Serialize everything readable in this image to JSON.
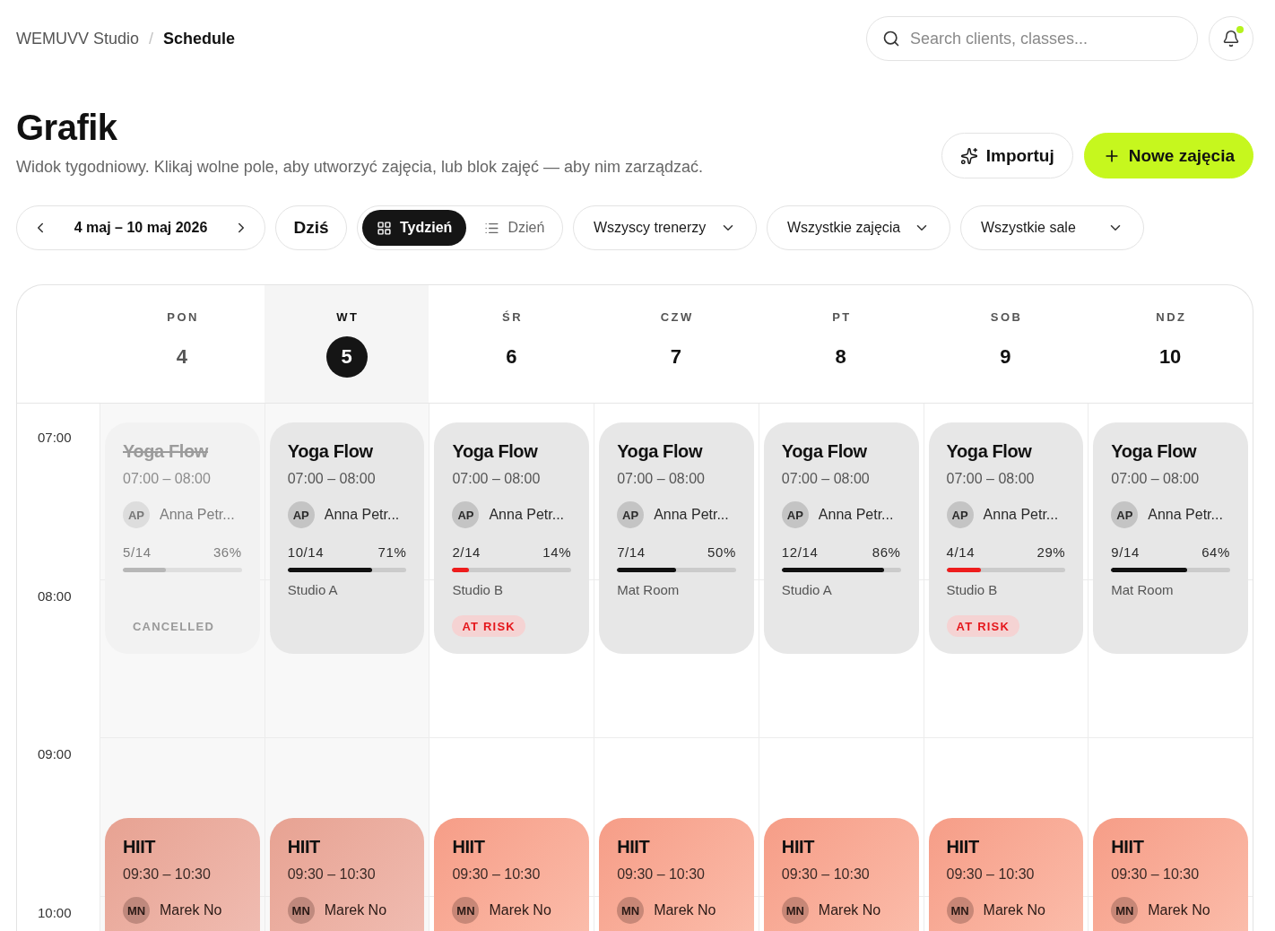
{
  "breadcrumb": {
    "parent": "WEMUVV Studio",
    "separator": "/",
    "current": "Schedule"
  },
  "search": {
    "placeholder": "Search clients, classes..."
  },
  "notifications": {
    "unread": true
  },
  "header": {
    "title": "Grafik",
    "subtitle": "Widok tygodniowy. Klikaj wolne pole, aby utworzyć zajęcia, lub blok zajęć — aby nim zarządzać."
  },
  "actions": [
    {
      "kind": "import",
      "label": "Importuj"
    },
    {
      "kind": "create",
      "label": "Nowe zajęcia"
    }
  ],
  "toolbar": {
    "date_range": "4 maj – 10 maj 2026",
    "today_button": "Dziś",
    "views": [
      {
        "kind": "week",
        "label": "Tydzień",
        "selected": true
      },
      {
        "kind": "day",
        "label": "Dzień",
        "selected": false
      }
    ],
    "filters": [
      "Wszyscy trenerzy",
      "Wszystkie zajęcia",
      "Wszystkie sale"
    ]
  },
  "calendar": {
    "hours": [
      "07:00",
      "08:00",
      "09:00",
      "10:00"
    ],
    "days": [
      {
        "label": "PON",
        "date": "4",
        "past": true,
        "today": false,
        "events": [
          {
            "kind": "yoga",
            "title": "Yoga Flow",
            "time": "07:00 – 08:00",
            "initials": "AP",
            "trainer": "Anna Petr...",
            "booked": "5/14",
            "percent": "36%",
            "level": 0.36,
            "cancelled": true,
            "at_risk": false,
            "badge": "CANCELLED"
          },
          {
            "kind": "hiit",
            "title": "HIIT",
            "time": "09:30 – 10:30",
            "initials": "MN",
            "trainer": "Marek No"
          }
        ]
      },
      {
        "label": "WT",
        "date": "5",
        "past": false,
        "today": true,
        "events": [
          {
            "kind": "yoga",
            "title": "Yoga Flow",
            "time": "07:00 – 08:00",
            "initials": "AP",
            "trainer": "Anna Petr...",
            "booked": "10/14",
            "percent": "71%",
            "level": 0.71,
            "cancelled": false,
            "at_risk": false,
            "room": "Studio A"
          },
          {
            "kind": "hiit",
            "title": "HIIT",
            "time": "09:30 – 10:30",
            "initials": "MN",
            "trainer": "Marek No"
          }
        ]
      },
      {
        "label": "ŚR",
        "date": "6",
        "past": false,
        "today": false,
        "events": [
          {
            "kind": "yoga",
            "title": "Yoga Flow",
            "time": "07:00 – 08:00",
            "initials": "AP",
            "trainer": "Anna Petr...",
            "booked": "2/14",
            "percent": "14%",
            "level": 0.14,
            "cancelled": false,
            "at_risk": true,
            "room": "Studio B",
            "badge": "AT RISK"
          },
          {
            "kind": "hiit",
            "title": "HIIT",
            "time": "09:30 – 10:30",
            "initials": "MN",
            "trainer": "Marek No"
          }
        ]
      },
      {
        "label": "CZW",
        "date": "7",
        "past": false,
        "today": false,
        "events": [
          {
            "kind": "yoga",
            "title": "Yoga Flow",
            "time": "07:00 – 08:00",
            "initials": "AP",
            "trainer": "Anna Petr...",
            "booked": "7/14",
            "percent": "50%",
            "level": 0.5,
            "cancelled": false,
            "at_risk": false,
            "room": "Mat Room"
          },
          {
            "kind": "hiit",
            "title": "HIIT",
            "time": "09:30 – 10:30",
            "initials": "MN",
            "trainer": "Marek No"
          }
        ]
      },
      {
        "label": "PT",
        "date": "8",
        "past": false,
        "today": false,
        "events": [
          {
            "kind": "yoga",
            "title": "Yoga Flow",
            "time": "07:00 – 08:00",
            "initials": "AP",
            "trainer": "Anna Petr...",
            "booked": "12/14",
            "percent": "86%",
            "level": 0.86,
            "cancelled": false,
            "at_risk": false,
            "room": "Studio A"
          },
          {
            "kind": "hiit",
            "title": "HIIT",
            "time": "09:30 – 10:30",
            "initials": "MN",
            "trainer": "Marek No"
          }
        ]
      },
      {
        "label": "SOB",
        "date": "9",
        "past": false,
        "today": false,
        "events": [
          {
            "kind": "yoga",
            "title": "Yoga Flow",
            "time": "07:00 – 08:00",
            "initials": "AP",
            "trainer": "Anna Petr...",
            "booked": "4/14",
            "percent": "29%",
            "level": 0.29,
            "cancelled": false,
            "at_risk": true,
            "room": "Studio B",
            "badge": "AT RISK"
          },
          {
            "kind": "hiit",
            "title": "HIIT",
            "time": "09:30 – 10:30",
            "initials": "MN",
            "trainer": "Marek No"
          }
        ]
      },
      {
        "label": "NDZ",
        "date": "10",
        "past": false,
        "today": false,
        "events": [
          {
            "kind": "yoga",
            "title": "Yoga Flow",
            "time": "07:00 – 08:00",
            "initials": "AP",
            "trainer": "Anna Petr...",
            "booked": "9/14",
            "percent": "64%",
            "level": 0.64,
            "cancelled": false,
            "at_risk": false,
            "room": "Mat Room"
          },
          {
            "kind": "hiit",
            "title": "HIIT",
            "time": "09:30 – 10:30",
            "initials": "MN",
            "trainer": "Marek No"
          }
        ]
      }
    ]
  }
}
